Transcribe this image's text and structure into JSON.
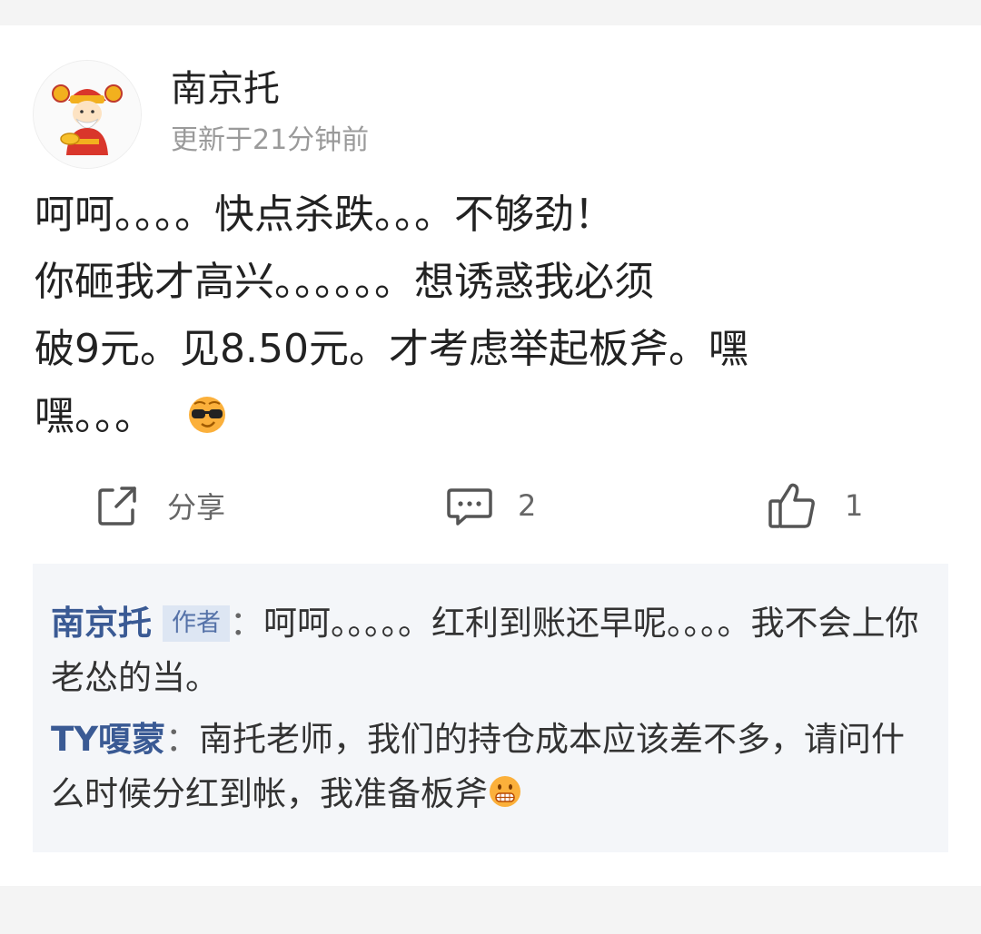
{
  "post": {
    "author": "南京托",
    "updated": "更新于21分钟前",
    "lines": [
      "呵呵。。。。快点杀跌。。。不够劲！",
      "你砸我才高兴。。。。。。想诱惑我必须",
      "破9元。见8.50元。才考虑举起板斧。嘿",
      "嘿。。。"
    ],
    "end_emoji": "cool-sunglasses-emoji"
  },
  "actions": {
    "share_label": "分享",
    "comment_count": "2",
    "like_count": "1"
  },
  "replies": [
    {
      "name": "南京托",
      "badge": "作者",
      "separator": "：",
      "text": "呵呵。。。。。红利到账还早呢。。。。我不会上你老怂的当。"
    },
    {
      "name": "TY嗄蒙",
      "separator": "：",
      "text": "南托老师，我们的持仓成本应该差不多，请问什么时候分红到帐，我准备板斧",
      "end_emoji": "grinning-emoji"
    }
  ],
  "colors": {
    "link": "#3a5a94",
    "badge_bg": "#dde6f3",
    "reply_bg": "#f4f6f9",
    "muted": "#9a9a9a"
  }
}
